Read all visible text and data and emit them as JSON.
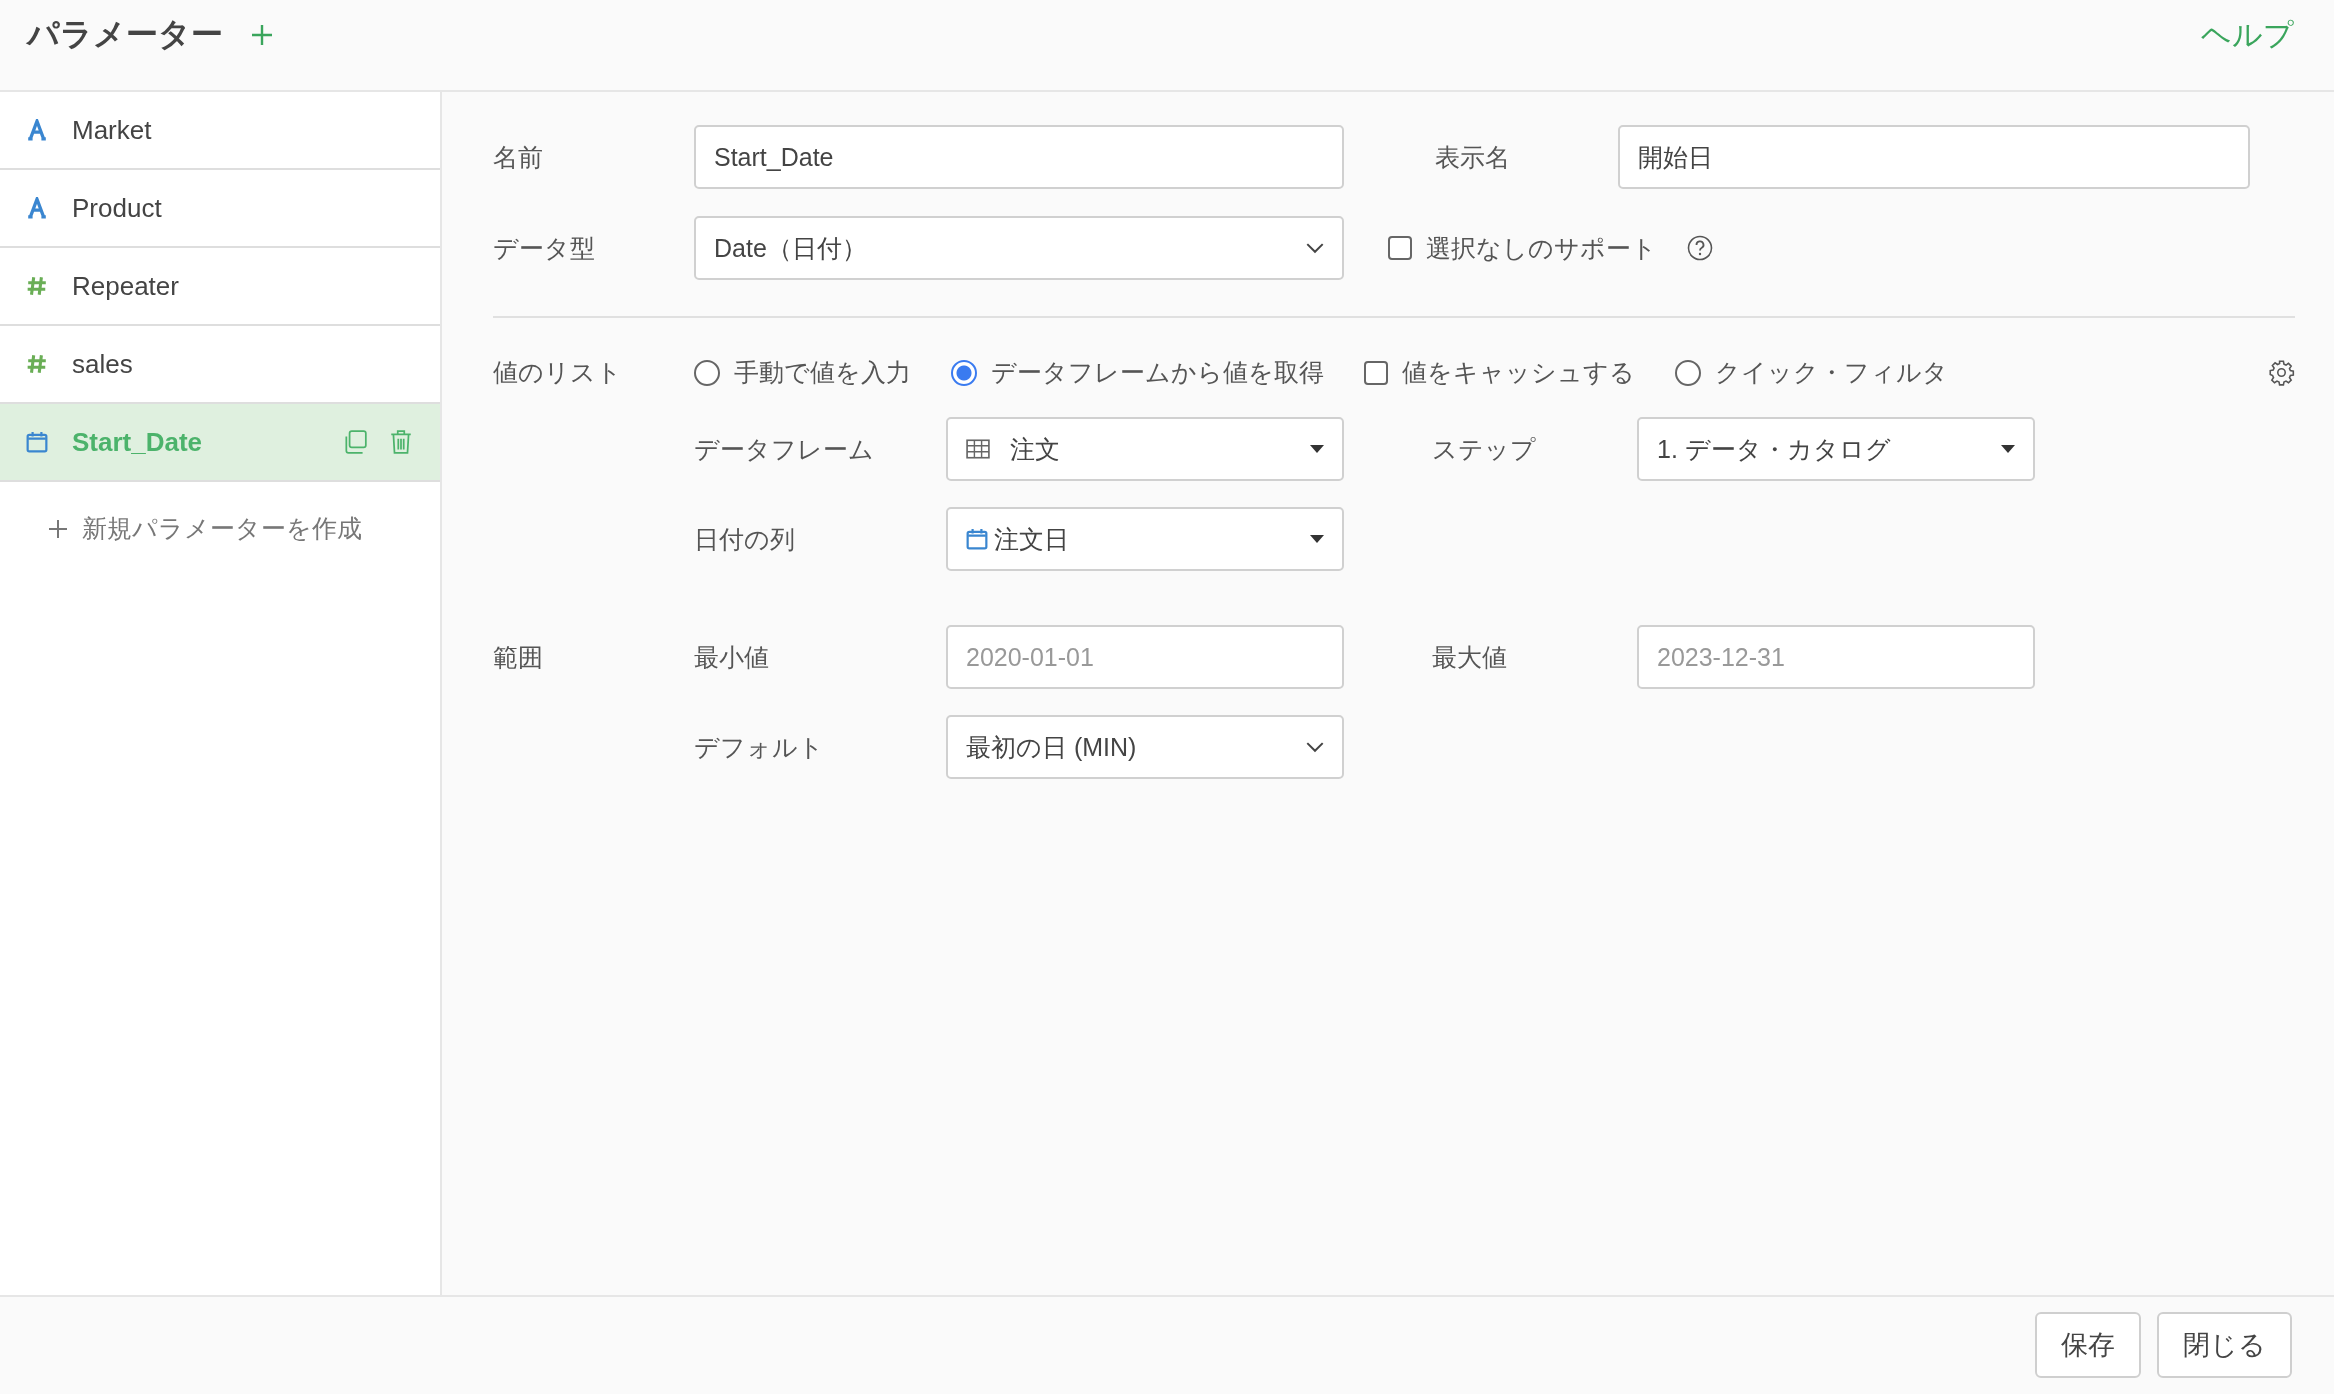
{
  "header": {
    "title": "パラメーター",
    "help_link": "ヘルプ"
  },
  "sidebar": {
    "items": [
      {
        "kind": "text",
        "label": "Market",
        "selected": false
      },
      {
        "kind": "text",
        "label": "Product",
        "selected": false
      },
      {
        "kind": "number",
        "label": "Repeater",
        "selected": false
      },
      {
        "kind": "number",
        "label": "sales",
        "selected": false
      },
      {
        "kind": "date",
        "label": "Start_Date",
        "selected": true
      }
    ],
    "new_parameter": "新規パラメーターを作成"
  },
  "form": {
    "name": {
      "label": "名前",
      "value": "Start_Date"
    },
    "display_name": {
      "label": "表示名",
      "value": "開始日"
    },
    "data_type": {
      "label": "データ型",
      "value": "Date（日付）"
    },
    "support_none": {
      "label": "選択なしのサポート",
      "checked": false
    },
    "values_list": {
      "label": "値のリスト",
      "options": [
        {
          "kind": "radio",
          "label": "手動で値を入力",
          "selected": false
        },
        {
          "kind": "radio",
          "label": "データフレームから値を取得",
          "selected": true
        },
        {
          "kind": "checkbox",
          "label": "値をキャッシュする",
          "checked": false
        },
        {
          "kind": "radio",
          "label": "クイック・フィルタ",
          "selected": false
        }
      ]
    },
    "dataframe": {
      "label": "データフレーム",
      "value": "注文"
    },
    "step": {
      "label": "ステップ",
      "value": "1. データ・カタログ"
    },
    "date_column": {
      "label": "日付の列",
      "value": "注文日"
    },
    "range": {
      "label": "範囲",
      "min": {
        "label": "最小値",
        "placeholder": "2020-01-01"
      },
      "max": {
        "label": "最大値",
        "placeholder": "2023-12-31"
      }
    },
    "default": {
      "label": "デフォルト",
      "value": "最初の日 (MIN)"
    }
  },
  "footer": {
    "buttons": [
      "保存",
      "閉じる"
    ]
  }
}
